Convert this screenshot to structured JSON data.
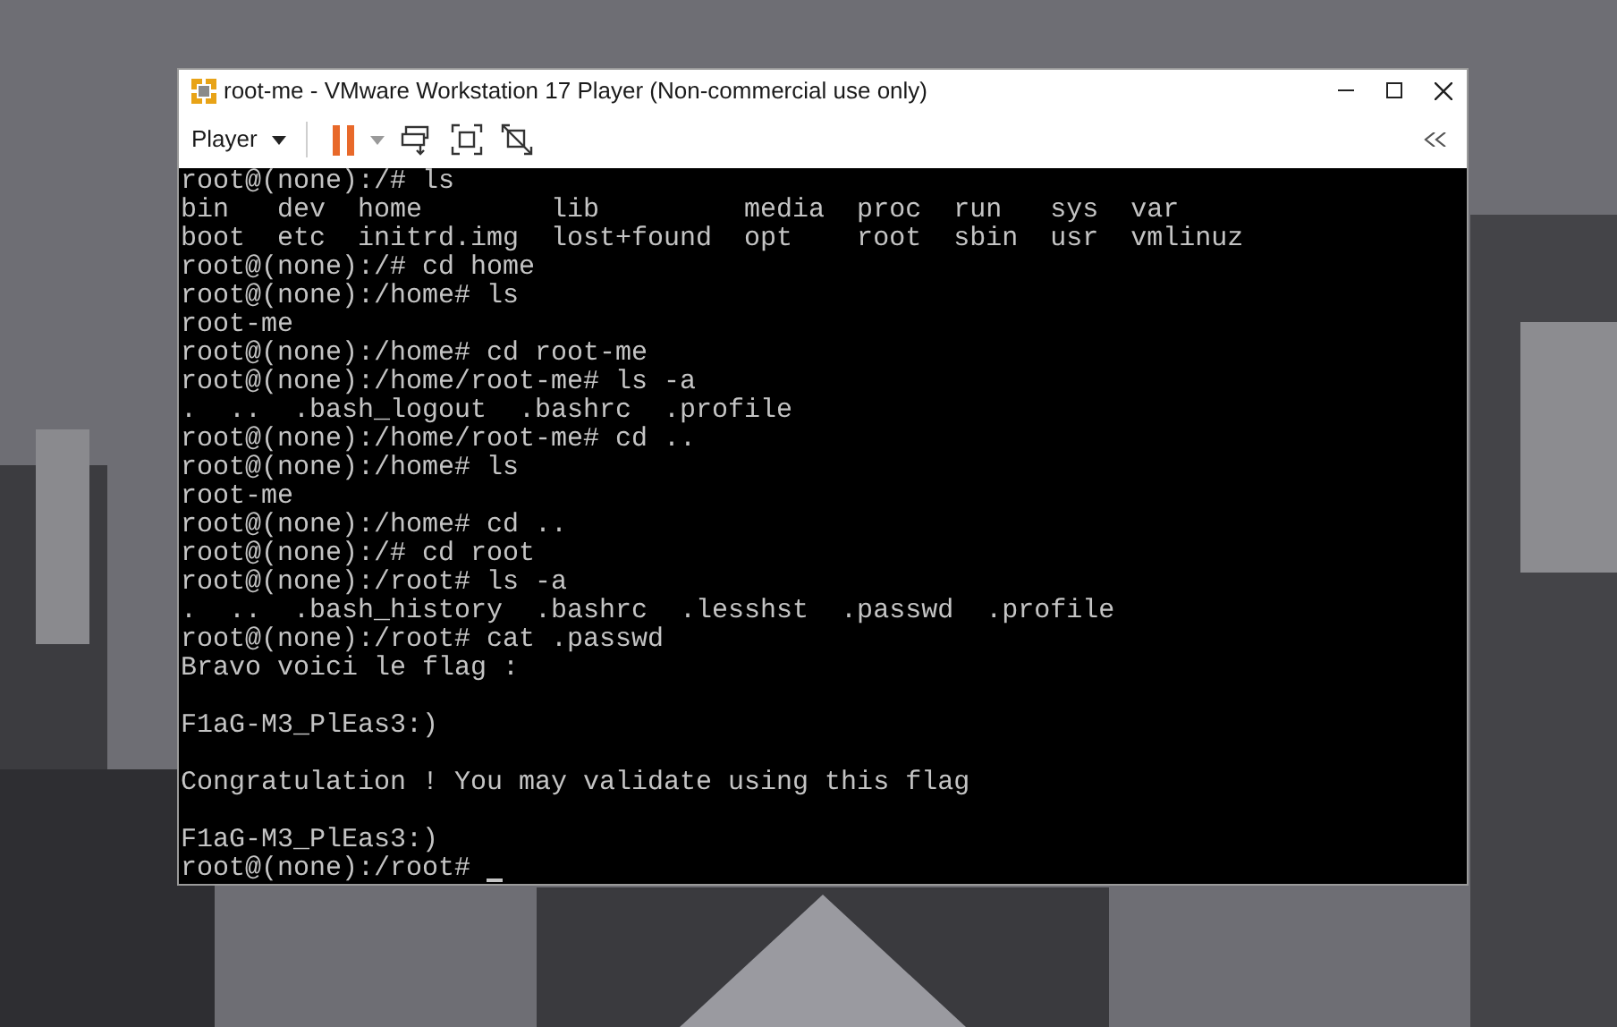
{
  "window": {
    "title": "root-me - VMware Workstation 17 Player (Non-commercial use only)"
  },
  "toolbar": {
    "menu": "Player"
  },
  "terminal": {
    "lines": [
      {
        "kind": "text",
        "text": "root@(none):/# ls"
      },
      {
        "kind": "text",
        "text": "bin   dev  home        lib         media  proc  run   sys  var"
      },
      {
        "kind": "text",
        "text": "boot  etc  initrd.img  lost+found  opt    root  sbin  usr  vmlinuz"
      },
      {
        "kind": "text",
        "text": "root@(none):/# cd home"
      },
      {
        "kind": "text",
        "text": "root@(none):/home# ls"
      },
      {
        "kind": "text",
        "text": "root-me"
      },
      {
        "kind": "text",
        "text": "root@(none):/home# cd root-me"
      },
      {
        "kind": "text",
        "text": "root@(none):/home/root-me# ls -a"
      },
      {
        "kind": "text",
        "text": ".  ..  .bash_logout  .bashrc  .profile"
      },
      {
        "kind": "text",
        "text": "root@(none):/home/root-me# cd .."
      },
      {
        "kind": "text",
        "text": "root@(none):/home# ls"
      },
      {
        "kind": "text",
        "text": "root-me"
      },
      {
        "kind": "text",
        "text": "root@(none):/home# cd .."
      },
      {
        "kind": "text",
        "text": "root@(none):/# cd root"
      },
      {
        "kind": "text",
        "text": "root@(none):/root# ls -a"
      },
      {
        "kind": "text",
        "text": ".  ..  .bash_history  .bashrc  .lesshst  .passwd  .profile"
      },
      {
        "kind": "text",
        "text": "root@(none):/root# cat .passwd"
      },
      {
        "kind": "text",
        "text": "Bravo voici le flag :"
      },
      {
        "kind": "blank"
      },
      {
        "kind": "text",
        "text": "F1aG-M3_PlEas3:)"
      },
      {
        "kind": "blank"
      },
      {
        "kind": "text",
        "text": "Congratulation ! You may validate using this flag"
      },
      {
        "kind": "blank"
      },
      {
        "kind": "text",
        "text": "F1aG-M3_PlEas3:)"
      },
      {
        "kind": "prompt",
        "text": "root@(none):/root#",
        "cursor": true
      }
    ]
  }
}
